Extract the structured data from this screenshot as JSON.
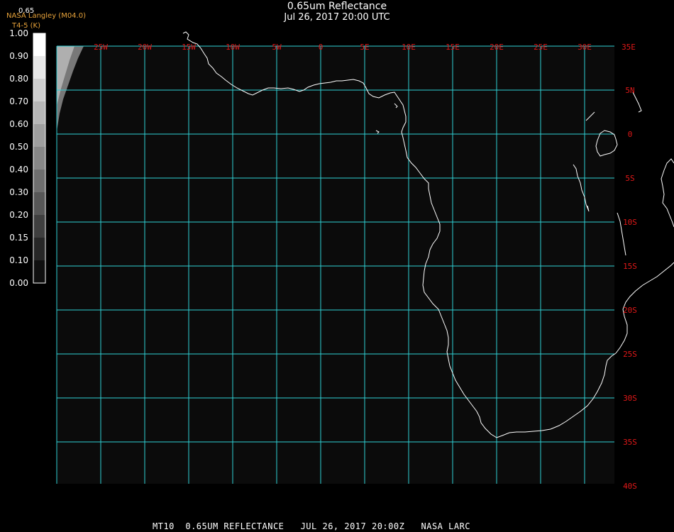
{
  "header": {
    "title": "0.65um Reflectance",
    "timestamp": "Jul 26, 2017 20:00 UTC",
    "source_label": "NASA Langley (M04.0)",
    "temp_label": "T4-5 (K)",
    "corner_label": "0.65"
  },
  "colorbar": {
    "ticks": [
      "1.00",
      "0.90",
      "0.80",
      "0.70",
      "0.60",
      "0.50",
      "0.40",
      "0.30",
      "0.20",
      "0.15",
      "0.10",
      "0.00"
    ]
  },
  "grid": {
    "longitudes": [
      "25W",
      "20W",
      "15W",
      "10W",
      "5W",
      "0",
      "5E",
      "10E",
      "15E",
      "20E",
      "25E",
      "30E",
      "35E"
    ],
    "latitudes": [
      "5N",
      "0",
      "5S",
      "10S",
      "15S",
      "20S",
      "25S",
      "30S",
      "35S",
      "40S"
    ]
  },
  "colors": {
    "grid": "#2fd0d6",
    "grid_label": "#e01818",
    "coastline": "#ffffff",
    "background": "#0b0b0b",
    "source_text": "#e8a33a"
  },
  "footer": {
    "text": "MT10  0.65UM REFLECTANCE   JUL 26, 2017 20:00Z   NASA LARC"
  }
}
